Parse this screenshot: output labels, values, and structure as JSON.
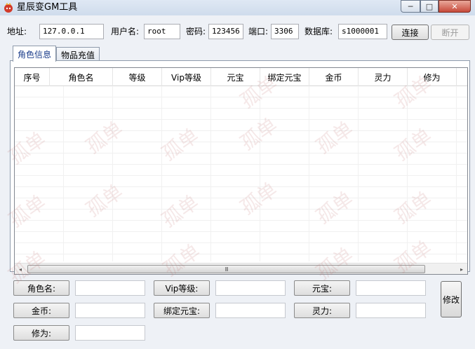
{
  "window": {
    "title": "星辰变GM工具",
    "controls": {
      "minimize": "─",
      "maximize": "□",
      "close": "✕"
    }
  },
  "connection": {
    "address_label": "地址:",
    "address_value": "127.0.0.1",
    "username_label": "用户名:",
    "username_value": "root",
    "password_label": "密码:",
    "password_value": "123456",
    "port_label": "端口:",
    "port_value": "3306",
    "database_label": "数据库:",
    "database_value": "s1000001",
    "connect_label": "连接",
    "disconnect_label": "断开"
  },
  "tabs": [
    {
      "label": "角色信息",
      "active": true
    },
    {
      "label": "物品充值",
      "active": false
    }
  ],
  "grid": {
    "columns": [
      "序号",
      "角色名",
      "等级",
      "Vip等级",
      "元宝",
      "绑定元宝",
      "金币",
      "灵力",
      "修为"
    ],
    "rows": []
  },
  "scrollbar": {
    "left": "◂",
    "thumb": "III",
    "right": "▸"
  },
  "form": {
    "role_name_label": "角色名:",
    "vip_label": "Vip等级:",
    "ingot_label": "元宝:",
    "gold_label": "金币:",
    "bound_ingot_label": "绑定元宝:",
    "spirit_label": "灵力:",
    "cultivation_label": "修为:",
    "modify_label": "修改"
  },
  "watermark": {
    "text": "孤单"
  },
  "colors": {
    "background": "#eef1f6",
    "accent": "#1a3c8a",
    "close": "#c7493a"
  }
}
